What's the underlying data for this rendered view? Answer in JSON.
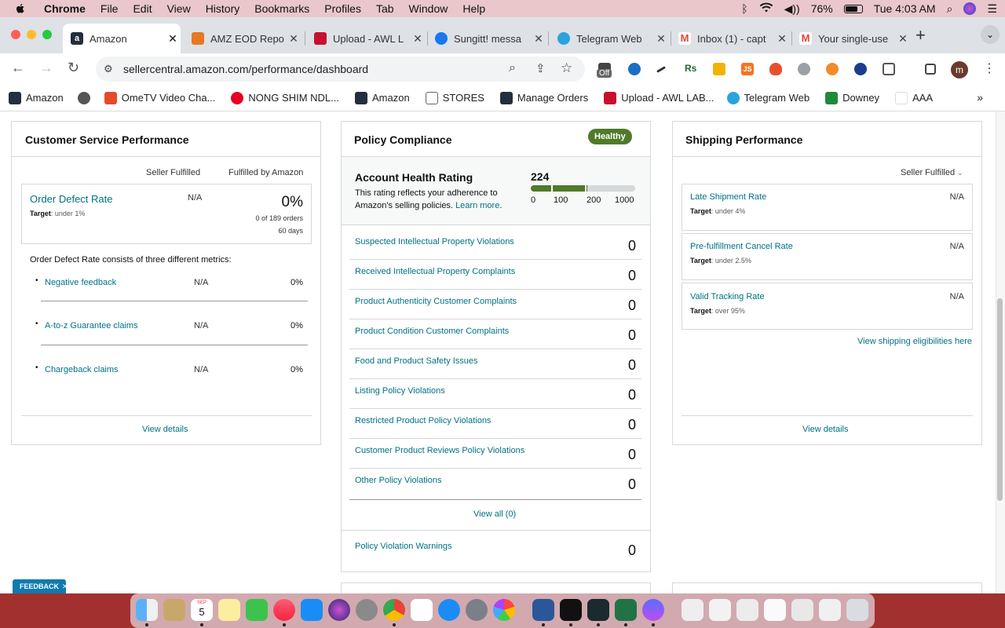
{
  "menubar": {
    "app": "Chrome",
    "items": [
      "File",
      "Edit",
      "View",
      "History",
      "Bookmarks",
      "Profiles",
      "Tab",
      "Window",
      "Help"
    ],
    "battery": "76%",
    "clock": "Tue 4:03 AM"
  },
  "tabs": [
    {
      "title": "Amazon",
      "color": "#232f3e"
    },
    {
      "title": "AMZ EOD Repo",
      "color": "#e87722"
    },
    {
      "title": "Upload - AWL L",
      "color": "#c8102e"
    },
    {
      "title": "Sungitt! messa",
      "color": "#1877f2"
    },
    {
      "title": "Telegram Web",
      "color": "#2aa3df"
    },
    {
      "title": "Inbox (1) - capt",
      "color": "#ea4335"
    },
    {
      "title": "Your single-use",
      "color": "#ea4335"
    }
  ],
  "toolbar": {
    "url": "sellercentral.amazon.com/performance/dashboard",
    "ext_off_label": "Off",
    "profile_initial": "m"
  },
  "bookmarks": [
    {
      "label": "Amazon",
      "color": "#232f3e"
    },
    {
      "label": "",
      "color": "#555"
    },
    {
      "label": "OmeTV Video Cha...",
      "color": "#e34b2b"
    },
    {
      "label": "NONG SHIM NDL...",
      "color": "#e60023"
    },
    {
      "label": "Amazon",
      "color": "#232f3e"
    },
    {
      "label": "STORES",
      "color": "#888"
    },
    {
      "label": "Manage Orders",
      "color": "#232f3e"
    },
    {
      "label": "Upload - AWL LAB...",
      "color": "#c8102e"
    },
    {
      "label": "Telegram Web",
      "color": "#2aa3df"
    },
    {
      "label": "Downey",
      "color": "#1f8a3b"
    },
    {
      "label": "AAA",
      "color": "#fff"
    }
  ],
  "csp": {
    "title": "Customer Service Performance",
    "col1": "Seller Fulfilled",
    "col2": "Fulfilled by Amazon",
    "odr_label": "Order Defect Rate",
    "odr_target_label": "Target",
    "odr_target_value": ": under 1%",
    "odr_sf": "N/A",
    "odr_fba": "0%",
    "odr_orders": "0 of 189 orders",
    "odr_days": "60 days",
    "consists": "Order Defect Rate consists of three different metrics:",
    "metrics": [
      {
        "label": "Negative feedback",
        "sf": "N/A",
        "fba": "0%"
      },
      {
        "label": "A-to-z Guarantee claims",
        "sf": "N/A",
        "fba": "0%"
      },
      {
        "label": "Chargeback claims",
        "sf": "N/A",
        "fba": "0%"
      }
    ],
    "view_details": "View details"
  },
  "policy": {
    "title": "Policy Compliance",
    "badge": "Healthy",
    "ahr_title": "Account Health Rating",
    "ahr_desc1": "This rating reflects your adherence to",
    "ahr_desc2": "Amazon's selling policies.",
    "learn_more": "Learn more",
    "ahr_value": "224",
    "ahr_fill_fraction": 0.224,
    "scale": [
      "0",
      "100",
      "200",
      "1000"
    ],
    "rows": [
      {
        "label": "Suspected Intellectual Property Violations",
        "value": "0"
      },
      {
        "label": "Received Intellectual Property Complaints",
        "value": "0"
      },
      {
        "label": "Product Authenticity Customer Complaints",
        "value": "0"
      },
      {
        "label": "Product Condition Customer Complaints",
        "value": "0"
      },
      {
        "label": "Food and Product Safety Issues",
        "value": "0"
      },
      {
        "label": "Listing Policy Violations",
        "value": "0"
      },
      {
        "label": "Restricted Product Policy Violations",
        "value": "0"
      },
      {
        "label": "Customer Product Reviews Policy Violations",
        "value": "0"
      },
      {
        "label": "Other Policy Violations",
        "value": "0"
      }
    ],
    "view_all": "View all (0)",
    "warnings_label": "Policy Violation Warnings",
    "warnings_value": "0"
  },
  "shipping": {
    "title": "Shipping Performance",
    "selector": "Seller Fulfilled",
    "metrics": [
      {
        "label": "Late Shipment Rate",
        "target_label": "Target",
        "target_value": ": under 4%",
        "value": "N/A"
      },
      {
        "label": "Pre-fulfillment Cancel Rate",
        "target_label": "Target",
        "target_value": ": under 2.5%",
        "value": "N/A"
      },
      {
        "label": "Valid Tracking Rate",
        "target_label": "Target",
        "target_value": ": over 95%",
        "value": "N/A"
      }
    ],
    "eligibilities": "View shipping eligibilities here",
    "view_details": "View details"
  },
  "feedback": "FEEDBACK",
  "dock_calendar_day": "5",
  "dock_calendar_month": "SEP"
}
